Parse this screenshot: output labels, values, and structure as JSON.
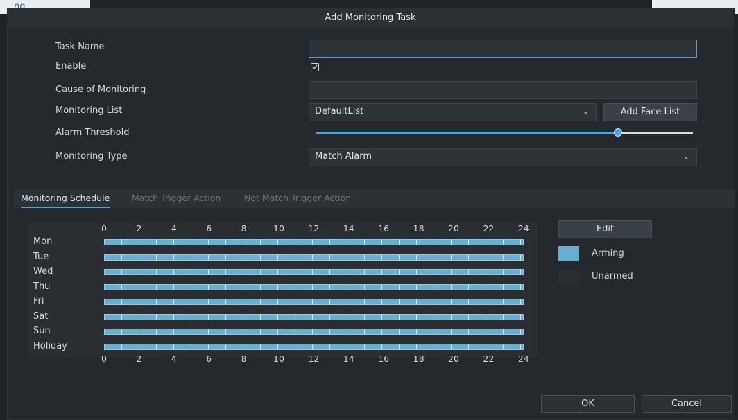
{
  "window": {
    "title": "Add Monitoring Task",
    "top_left_fragment": "ng"
  },
  "form": {
    "task_name": {
      "label": "Task Name",
      "value": ""
    },
    "enable": {
      "label": "Enable",
      "checked": true
    },
    "cause": {
      "label": "Cause of Monitoring",
      "value": ""
    },
    "monitoring_list": {
      "label": "Monitoring List",
      "value": "DefaultList",
      "add_button": "Add Face List"
    },
    "alarm_threshold": {
      "label": "Alarm Threshold",
      "level": 0.8
    },
    "monitoring_type": {
      "label": "Monitoring Type",
      "value": "Match Alarm"
    }
  },
  "tabs": [
    {
      "label": "Monitoring Schedule",
      "active": true
    },
    {
      "label": "Match Trigger Action",
      "active": false
    },
    {
      "label": "Not Match Trigger Action",
      "active": false
    }
  ],
  "schedule": {
    "hours": [
      "0",
      "2",
      "4",
      "6",
      "8",
      "10",
      "12",
      "14",
      "16",
      "18",
      "20",
      "22",
      "24"
    ],
    "days": [
      "Mon",
      "Tue",
      "Wed",
      "Thu",
      "Fri",
      "Sat",
      "Sun",
      "Holiday"
    ],
    "edit_button": "Edit",
    "legend": [
      {
        "label": "Arming",
        "color": "#6aaecf"
      },
      {
        "label": "Unarmed",
        "color": "#2a2e33"
      }
    ]
  },
  "footer": {
    "ok_label": "OK",
    "cancel_label": "Cancel"
  }
}
